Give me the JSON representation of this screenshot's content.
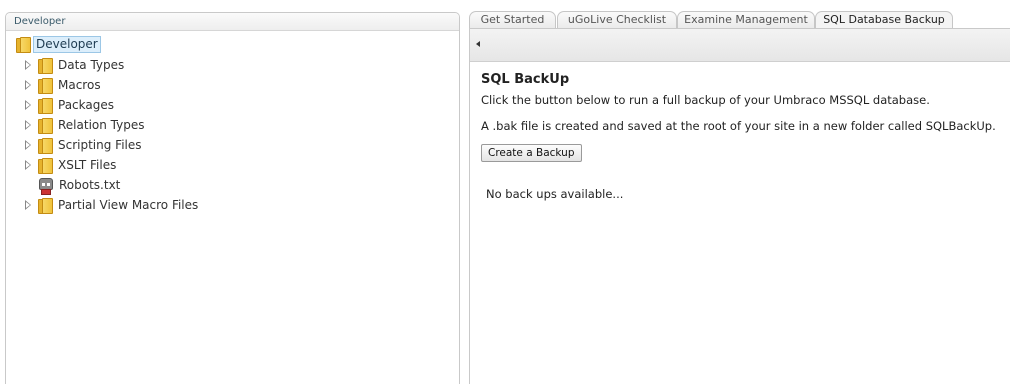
{
  "left_panel": {
    "header": "Developer",
    "root_label": "Developer",
    "items": [
      {
        "label": "Data Types",
        "type": "folder"
      },
      {
        "label": "Macros",
        "type": "folder"
      },
      {
        "label": "Packages",
        "type": "folder"
      },
      {
        "label": "Relation Types",
        "type": "folder"
      },
      {
        "label": "Scripting Files",
        "type": "folder"
      },
      {
        "label": "XSLT Files",
        "type": "folder"
      },
      {
        "label": "Robots.txt",
        "type": "file"
      },
      {
        "label": "Partial View Macro Files",
        "type": "folder"
      }
    ]
  },
  "tabs": [
    {
      "label": "Get Started"
    },
    {
      "label": "uGoLive Checklist"
    },
    {
      "label": "Examine Management"
    },
    {
      "label": "SQL Database Backup"
    }
  ],
  "active_tab": "SQL Database Backup",
  "content": {
    "title": "SQL BackUp",
    "description": "Click the button below to run a full backup of your Umbraco MSSQL database.",
    "note": "A .bak file is created and saved at the root of your site in a new folder called SQLBackUp.",
    "button_label": "Create a Backup",
    "status": "No back ups available..."
  },
  "colors": {
    "folder": "#f0c33c",
    "selection_bg": "#dceefb"
  }
}
